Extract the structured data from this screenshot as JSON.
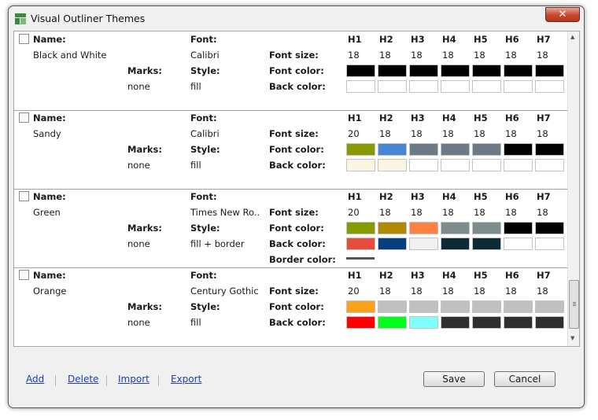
{
  "window": {
    "title": "Visual Outliner Themes",
    "close_glyph": "✕"
  },
  "labels": {
    "name": "Name:",
    "font": "Font:",
    "marks": "Marks:",
    "style": "Style:",
    "font_size": "Font size:",
    "font_color": "Font color:",
    "back_color": "Back color:",
    "border_color": "Border color:"
  },
  "heading_levels": [
    "H1",
    "H2",
    "H3",
    "H4",
    "H5",
    "H6",
    "H7"
  ],
  "themes": [
    {
      "name": "Black and White",
      "font": "Calibri",
      "marks": "none",
      "style": "fill",
      "font_sizes": [
        "18",
        "18",
        "18",
        "18",
        "18",
        "18",
        "18"
      ],
      "font_colors": [
        "#000000",
        "#000000",
        "#000000",
        "#000000",
        "#000000",
        "#000000",
        "#000000"
      ],
      "back_colors": [
        "#ffffff",
        "#ffffff",
        "#ffffff",
        "#ffffff",
        "#ffffff",
        "#ffffff",
        "#ffffff"
      ]
    },
    {
      "name": "Sandy",
      "font": "Calibri",
      "marks": "none",
      "style": "fill",
      "font_sizes": [
        "20",
        "18",
        "18",
        "18",
        "18",
        "18",
        "18"
      ],
      "font_colors": [
        "#879a00",
        "#4a86d8",
        "#6c7a85",
        "#6c7a85",
        "#6c7a85",
        "#000000",
        "#000000"
      ],
      "back_colors": [
        "#fbf4e3",
        "#fbf4e3",
        "#ffffff",
        "#ffffff",
        "#ffffff",
        "#ffffff",
        "#ffffff"
      ]
    },
    {
      "name": "Green",
      "font": "Times New Ro...",
      "marks": "none",
      "style": "fill + border",
      "font_sizes": [
        "20",
        "18",
        "18",
        "18",
        "18",
        "18",
        "18"
      ],
      "font_colors": [
        "#879a00",
        "#b08900",
        "#ff8040",
        "#7f8c8d",
        "#7f8c8d",
        "#000000",
        "#000000"
      ],
      "back_colors": [
        "#e74c3c",
        "#063f80",
        "#f0f0f0",
        "#0b2b36",
        "#0b2b36",
        "#ffffff",
        "#ffffff"
      ],
      "border_color": "#555555"
    },
    {
      "name": "Orange",
      "font": "Century Gothic",
      "marks": "none",
      "style": "fill",
      "font_sizes": [
        "20",
        "18",
        "18",
        "18",
        "18",
        "18",
        "18"
      ],
      "font_colors": [
        "#fba21c",
        "#c0c0c0",
        "#c0c0c0",
        "#c0c0c0",
        "#c0c0c0",
        "#c0c0c0",
        "#c0c0c0"
      ],
      "back_colors": [
        "#ff0000",
        "#00ff1a",
        "#80ffff",
        "#2d2f31",
        "#2d2f31",
        "#2d2f31",
        "#2d2f31"
      ]
    }
  ],
  "footer": {
    "links": [
      "Add",
      "Delete",
      "Import",
      "Export"
    ],
    "save_label": "Save",
    "cancel_label": "Cancel"
  }
}
